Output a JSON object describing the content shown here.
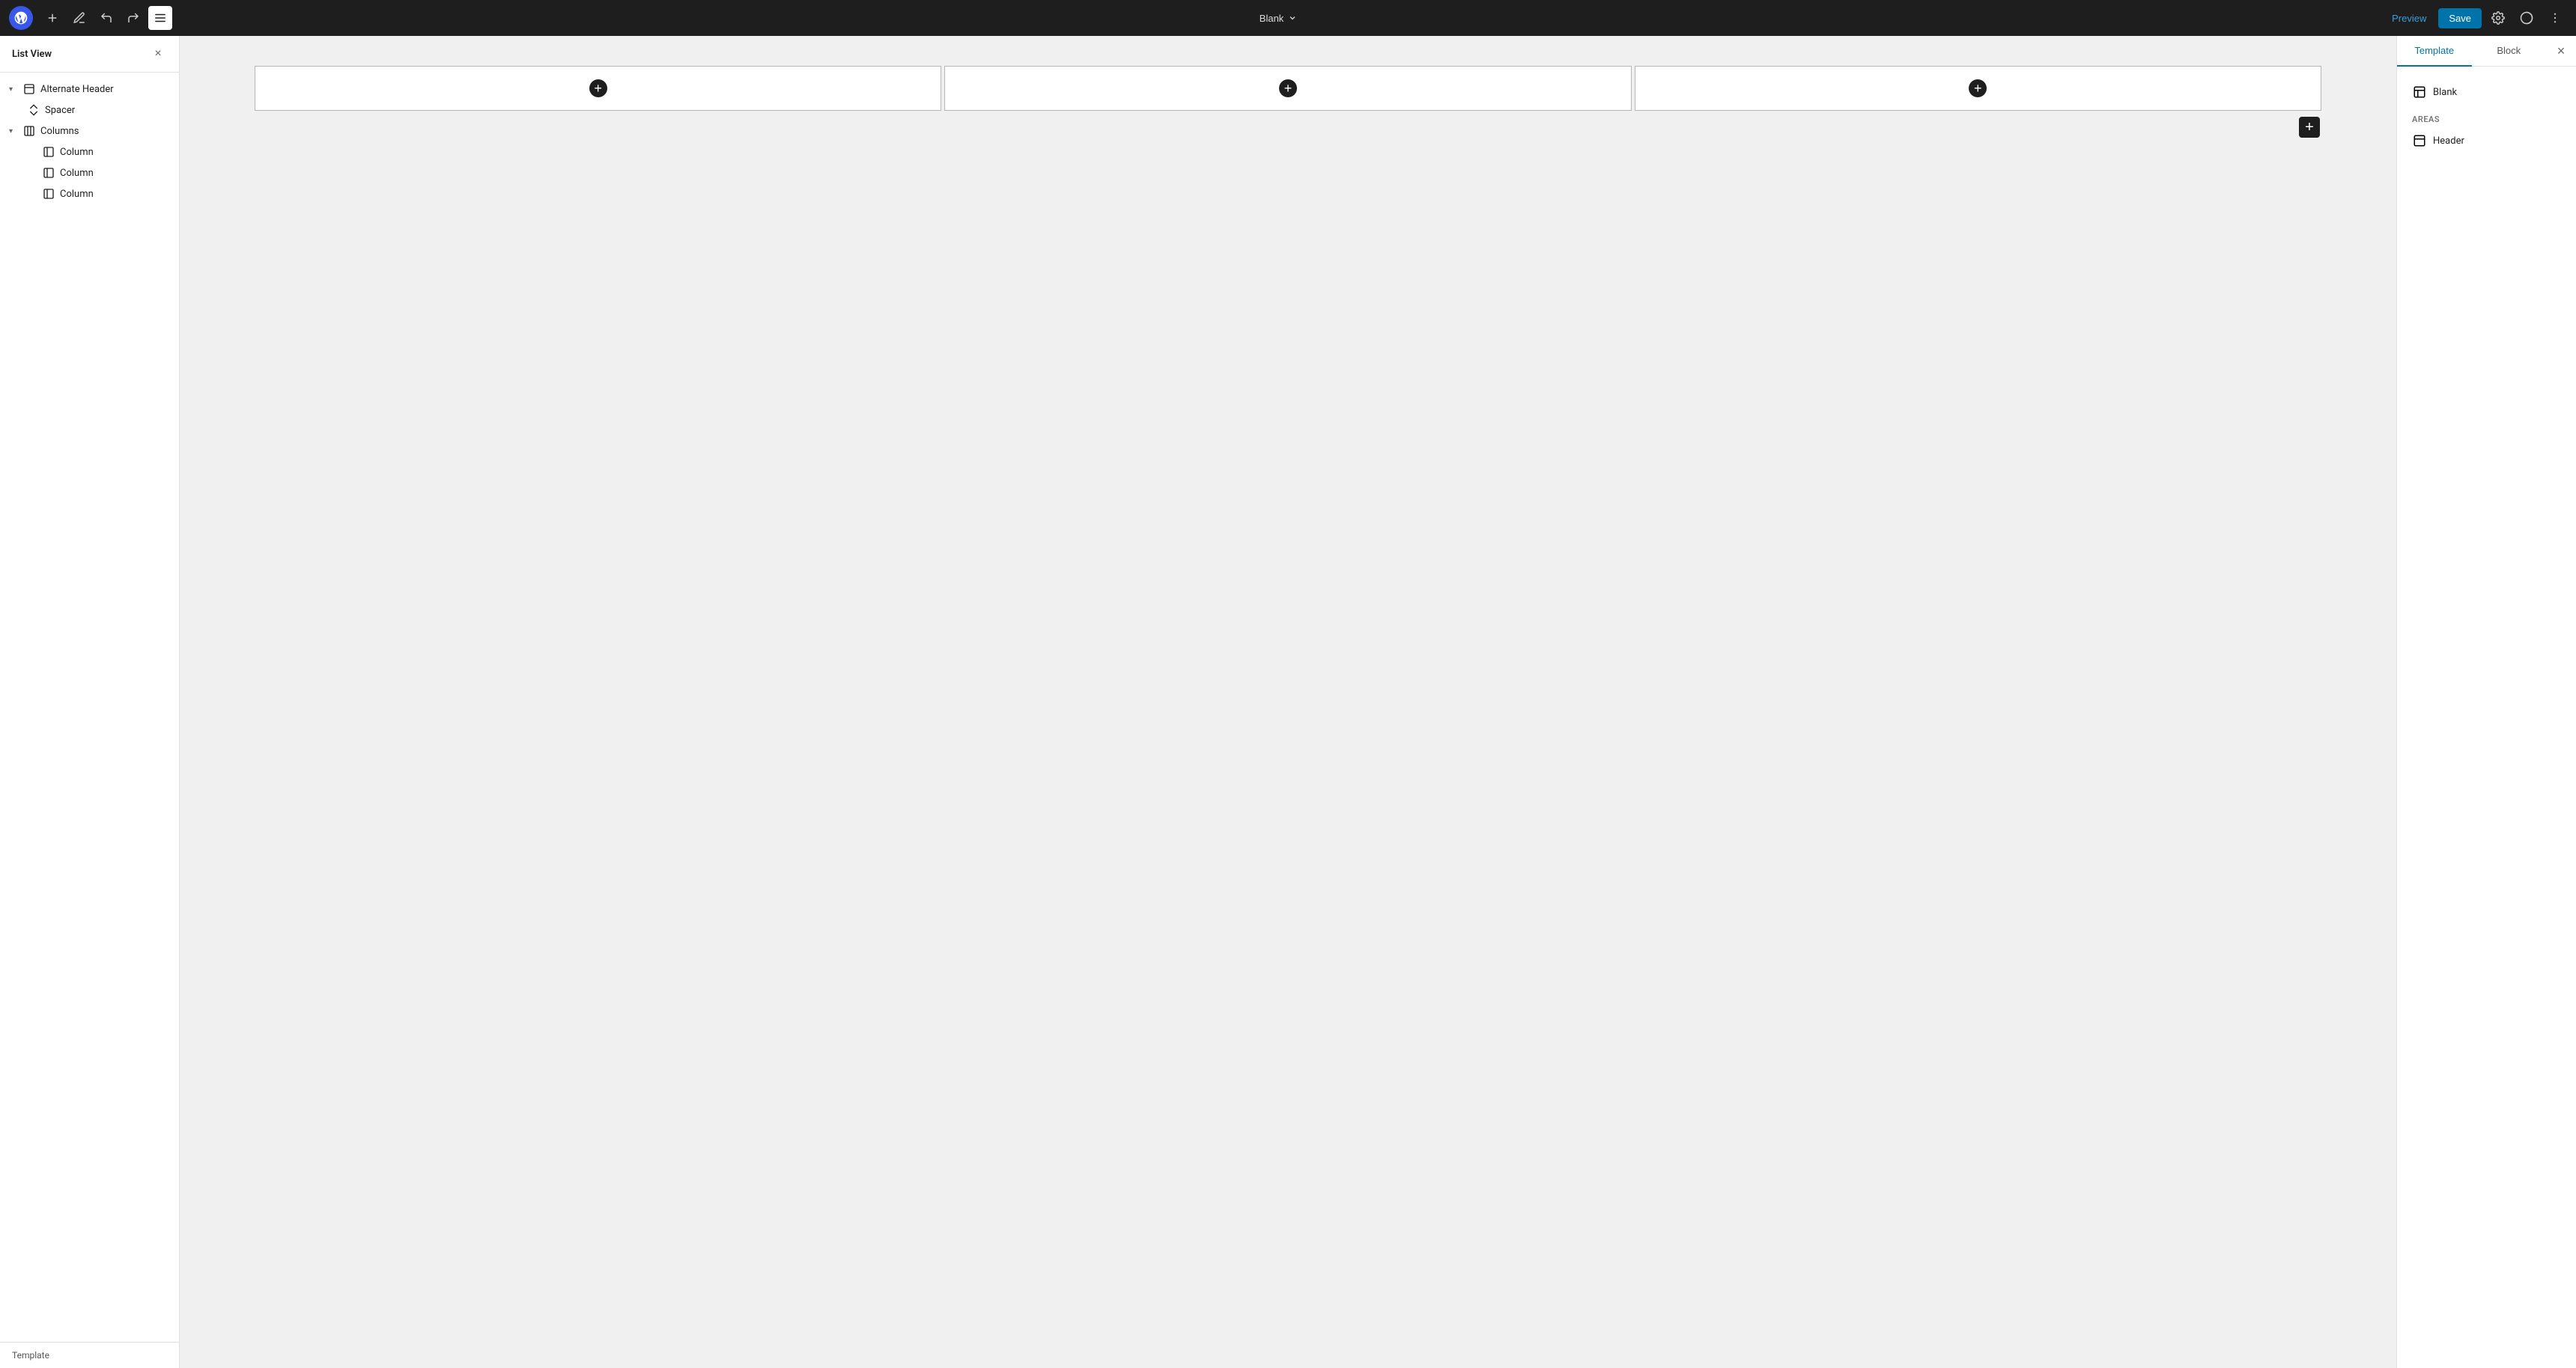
{
  "toolbar": {
    "logo_label": "WordPress",
    "add_label": "+",
    "undo_label": "↩",
    "redo_label": "↪",
    "document_title": "Blank",
    "preview_label": "Preview",
    "save_label": "Save"
  },
  "list_view": {
    "title": "List View",
    "close_label": "×",
    "items": [
      {
        "id": "alternate-header",
        "label": "Alternate Header",
        "level": 0,
        "has_children": true,
        "icon": "header-icon"
      },
      {
        "id": "spacer",
        "label": "Spacer",
        "level": 1,
        "has_children": false,
        "icon": "spacer-icon"
      },
      {
        "id": "columns",
        "label": "Columns",
        "level": 0,
        "has_children": true,
        "icon": "columns-icon"
      },
      {
        "id": "column-1",
        "label": "Column",
        "level": 2,
        "has_children": false,
        "icon": "column-icon"
      },
      {
        "id": "column-2",
        "label": "Column",
        "level": 2,
        "has_children": false,
        "icon": "column-icon"
      },
      {
        "id": "column-3",
        "label": "Column",
        "level": 2,
        "has_children": false,
        "icon": "column-icon"
      }
    ],
    "footer_label": "Template"
  },
  "canvas": {
    "columns": [
      {
        "id": "col-1",
        "add_label": "+"
      },
      {
        "id": "col-2",
        "add_label": "+"
      },
      {
        "id": "col-3",
        "add_label": "+"
      }
    ],
    "add_row_label": "+"
  },
  "right_panel": {
    "tabs": [
      {
        "id": "template",
        "label": "Template",
        "active": true
      },
      {
        "id": "block",
        "label": "Block",
        "active": false
      }
    ],
    "close_label": "×",
    "template_name": "Blank",
    "areas_label": "AREAS",
    "header_label": "Header"
  }
}
